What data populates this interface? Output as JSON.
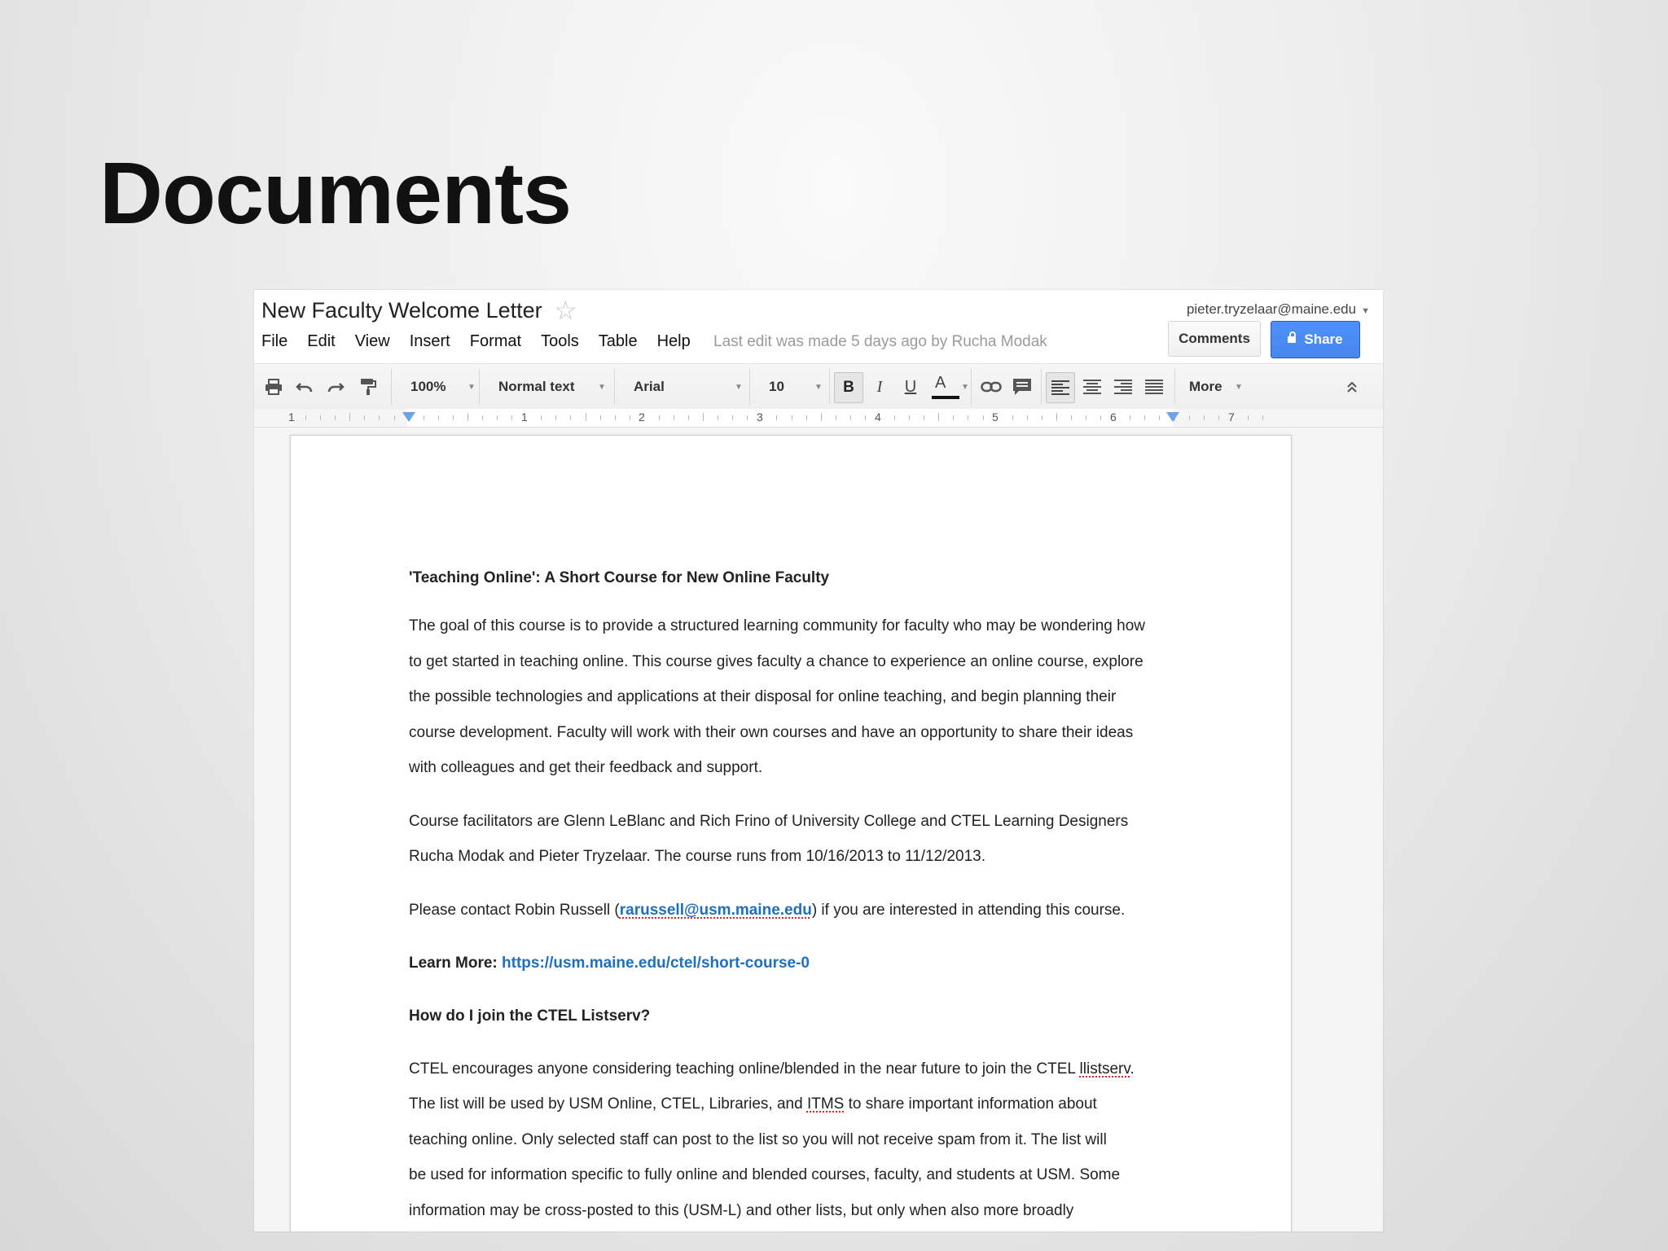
{
  "slide": {
    "title": "Documents"
  },
  "doc": {
    "title": "New Faculty Welcome Letter",
    "account": "pieter.tryzelaar@maine.edu",
    "last_edit": "Last edit was made 5 days ago by Rucha Modak",
    "comments_label": "Comments",
    "share_label": "Share"
  },
  "menu": [
    "File",
    "Edit",
    "View",
    "Insert",
    "Format",
    "Tools",
    "Table",
    "Help"
  ],
  "toolbar": {
    "zoom": "100%",
    "style": "Normal text",
    "font": "Arial",
    "size": "10",
    "bold": "B",
    "italic": "I",
    "underline": "U",
    "text_color": "A",
    "more": "More"
  },
  "ruler": {
    "numbers": [
      "1",
      "1",
      "2",
      "3",
      "4",
      "5",
      "6",
      "7"
    ]
  },
  "body": {
    "heading1": "'Teaching Online': A Short Course for New Online Faculty",
    "para1": [
      "The goal of this course is to provide a structured learning community for faculty who may be wondering how",
      "to get started in teaching online. This course gives faculty a chance to experience an online course, explore",
      "the possible technologies and applications at their disposal for online teaching, and begin planning their",
      "course development. Faculty will work with their own courses and have an opportunity to share their ideas",
      "with colleagues and get their feedback and support."
    ],
    "para2": [
      "Course facilitators are Glenn LeBlanc and Rich Frino of University College and CTEL Learning Designers",
      "Rucha Modak and Pieter Tryzelaar. The course runs from 10/16/2013 to 11/12/2013."
    ],
    "contact_pre": "Please contact Robin Russell (",
    "contact_email": "rarussell@usm.maine.edu",
    "contact_post": ") if you are interested in attending this course.",
    "learn_more_label": "Learn More:",
    "learn_more_url": "https://usm.maine.edu/ctel/short-course-0",
    "heading2": "How do I join the CTEL Listserv?",
    "para3_l1_pre": "CTEL encourages anyone considering teaching online/blended in the near future to join the CTEL ",
    "para3_l1_word": "llistserv",
    "para3_l1_post": ".",
    "para3_l2_pre": "The list will be used by USM Online, CTEL, Libraries, and ",
    "para3_l2_word": "ITMS",
    "para3_l2_post": " to share important information about",
    "para3_rest": [
      "teaching online.  Only selected staff can post to the list so you will not receive spam from it.  The list will",
      "be used for information specific to fully online and blended courses, faculty, and students at USM.  Some",
      "information may be cross-posted to this (USM-L) and other lists, but only when also more broadly"
    ]
  },
  "colors": {
    "link": "#1f6fba",
    "share_button": "#4787ed"
  }
}
